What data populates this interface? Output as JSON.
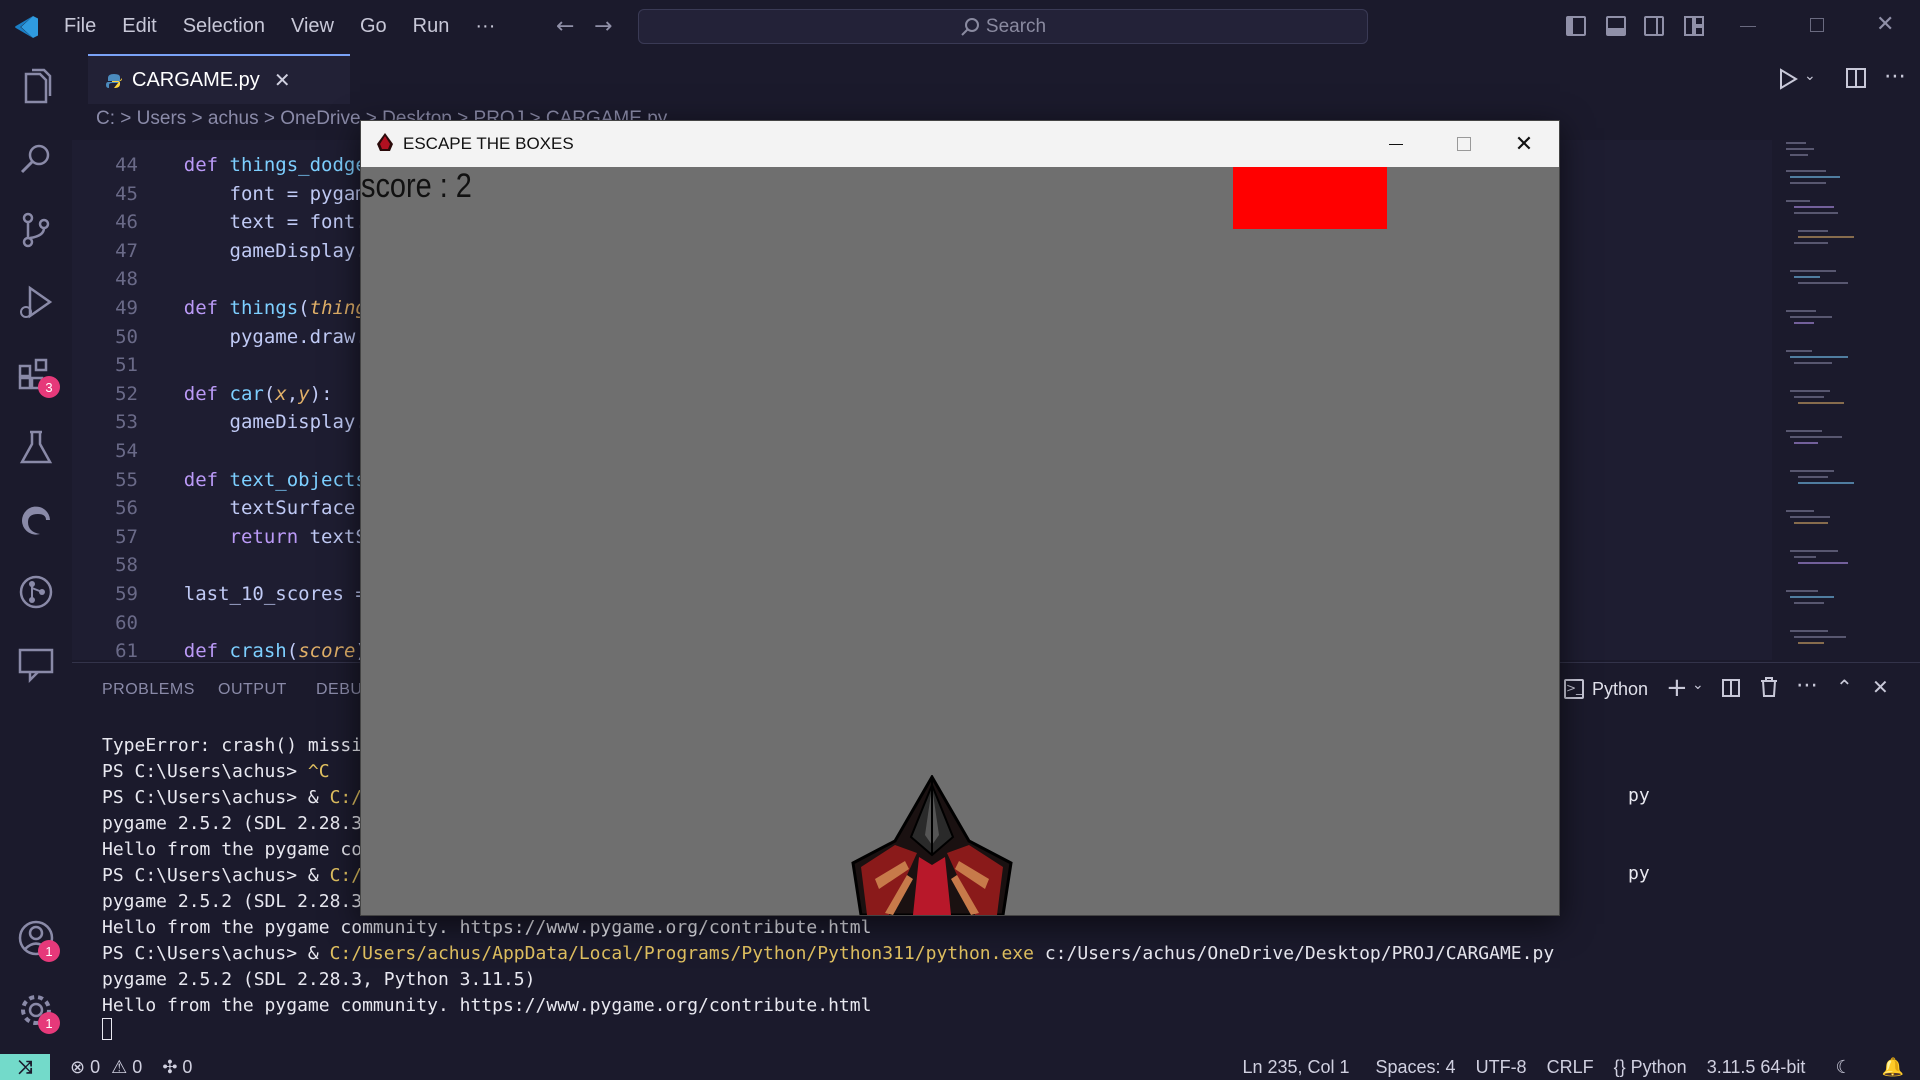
{
  "titlebar": {
    "menu": [
      "File",
      "Edit",
      "Selection",
      "View",
      "Go",
      "Run",
      "···"
    ],
    "search_placeholder": "Search"
  },
  "activity_badges": {
    "extensions": "3",
    "accounts": "1",
    "settings": "1"
  },
  "tab": {
    "filename": "CARGAME.py"
  },
  "breadcrumb": "C: > Users > achus > OneDrive > Desktop > PROJ > CARGAME.py",
  "code": [
    {
      "n": "44",
      "kw": "def ",
      "fn": "things_dodged",
      "rest": ""
    },
    {
      "n": "45",
      "indent": "    ",
      "plain": "font = pygam"
    },
    {
      "n": "46",
      "indent": "    ",
      "plain": "text = font."
    },
    {
      "n": "47",
      "indent": "    ",
      "plain": "gameDisplay."
    },
    {
      "n": "48",
      "plain": ""
    },
    {
      "n": "49",
      "kw": "def ",
      "fn": "things",
      "paren": "(",
      "param": "thing"
    },
    {
      "n": "50",
      "indent": "    ",
      "plain": "pygame.draw."
    },
    {
      "n": "51",
      "plain": ""
    },
    {
      "n": "52",
      "kw": "def ",
      "fn": "car",
      "paren": "(",
      "param": "x",
      "sep": ",",
      "param2": "y",
      "close": "):"
    },
    {
      "n": "53",
      "indent": "    ",
      "plain": "gameDisplay."
    },
    {
      "n": "54",
      "plain": ""
    },
    {
      "n": "55",
      "kw": "def ",
      "fn": "text_objects"
    },
    {
      "n": "56",
      "indent": "    ",
      "plain": "textSurface "
    },
    {
      "n": "57",
      "indent": "    ",
      "kwret": "return ",
      "plain": "textS"
    },
    {
      "n": "58",
      "plain": ""
    },
    {
      "n": "59",
      "plain": "last_10_scores ="
    },
    {
      "n": "60",
      "plain": ""
    },
    {
      "n": "61",
      "kw": "def ",
      "fn": "crash",
      "paren": "(",
      "param": "score",
      "close": ")"
    }
  ],
  "panel": {
    "tabs": [
      "PROBLEMS",
      "OUTPUT",
      "DEBU"
    ],
    "shell_label": "Python",
    "terminal": [
      {
        "a": "TypeError: crash() missi"
      },
      {
        "a": "PS C:\\Users\\achus> ",
        "y": "^C"
      },
      {
        "a": "PS C:\\Users\\achus> & ",
        "y": "C:/"
      },
      {
        "a": "pygame 2.5.2 (SDL 2.28.3"
      },
      {
        "a": "Hello from the pygame co"
      },
      {
        "a": "PS C:\\Users\\achus> & ",
        "y": "C:/"
      },
      {
        "a": "pygame 2.5.2 (SDL 2.28.3"
      },
      {
        "a": "Hello from the pygame community. https://www.pygame.org/contribute.html"
      },
      {
        "a": "PS C:\\Users\\achus> & ",
        "y": "C:/Users/achus/AppData/Local/Programs/Python/Python311/python.exe",
        "b": " c:/Users/achus/OneDrive/Desktop/PROJ/CARGAME.py"
      },
      {
        "a": "pygame 2.5.2 (SDL 2.28.3, Python 3.11.5)"
      },
      {
        "a": "Hello from the pygame community. https://www.pygame.org/contribute.html"
      }
    ],
    "right_frag_1": "py",
    "right_frag_2": "py"
  },
  "statusbar": {
    "errors": "0",
    "warnings": "0",
    "ports": "0",
    "position": "Ln 235, Col 1",
    "spaces": "Spaces: 4",
    "encoding": "UTF-8",
    "eol": "CRLF",
    "language": "Python",
    "interpreter": "3.11.5 64-bit"
  },
  "game": {
    "title": "ESCAPE THE BOXES",
    "score_text": "score : 2",
    "box_color": "#ff0000"
  }
}
